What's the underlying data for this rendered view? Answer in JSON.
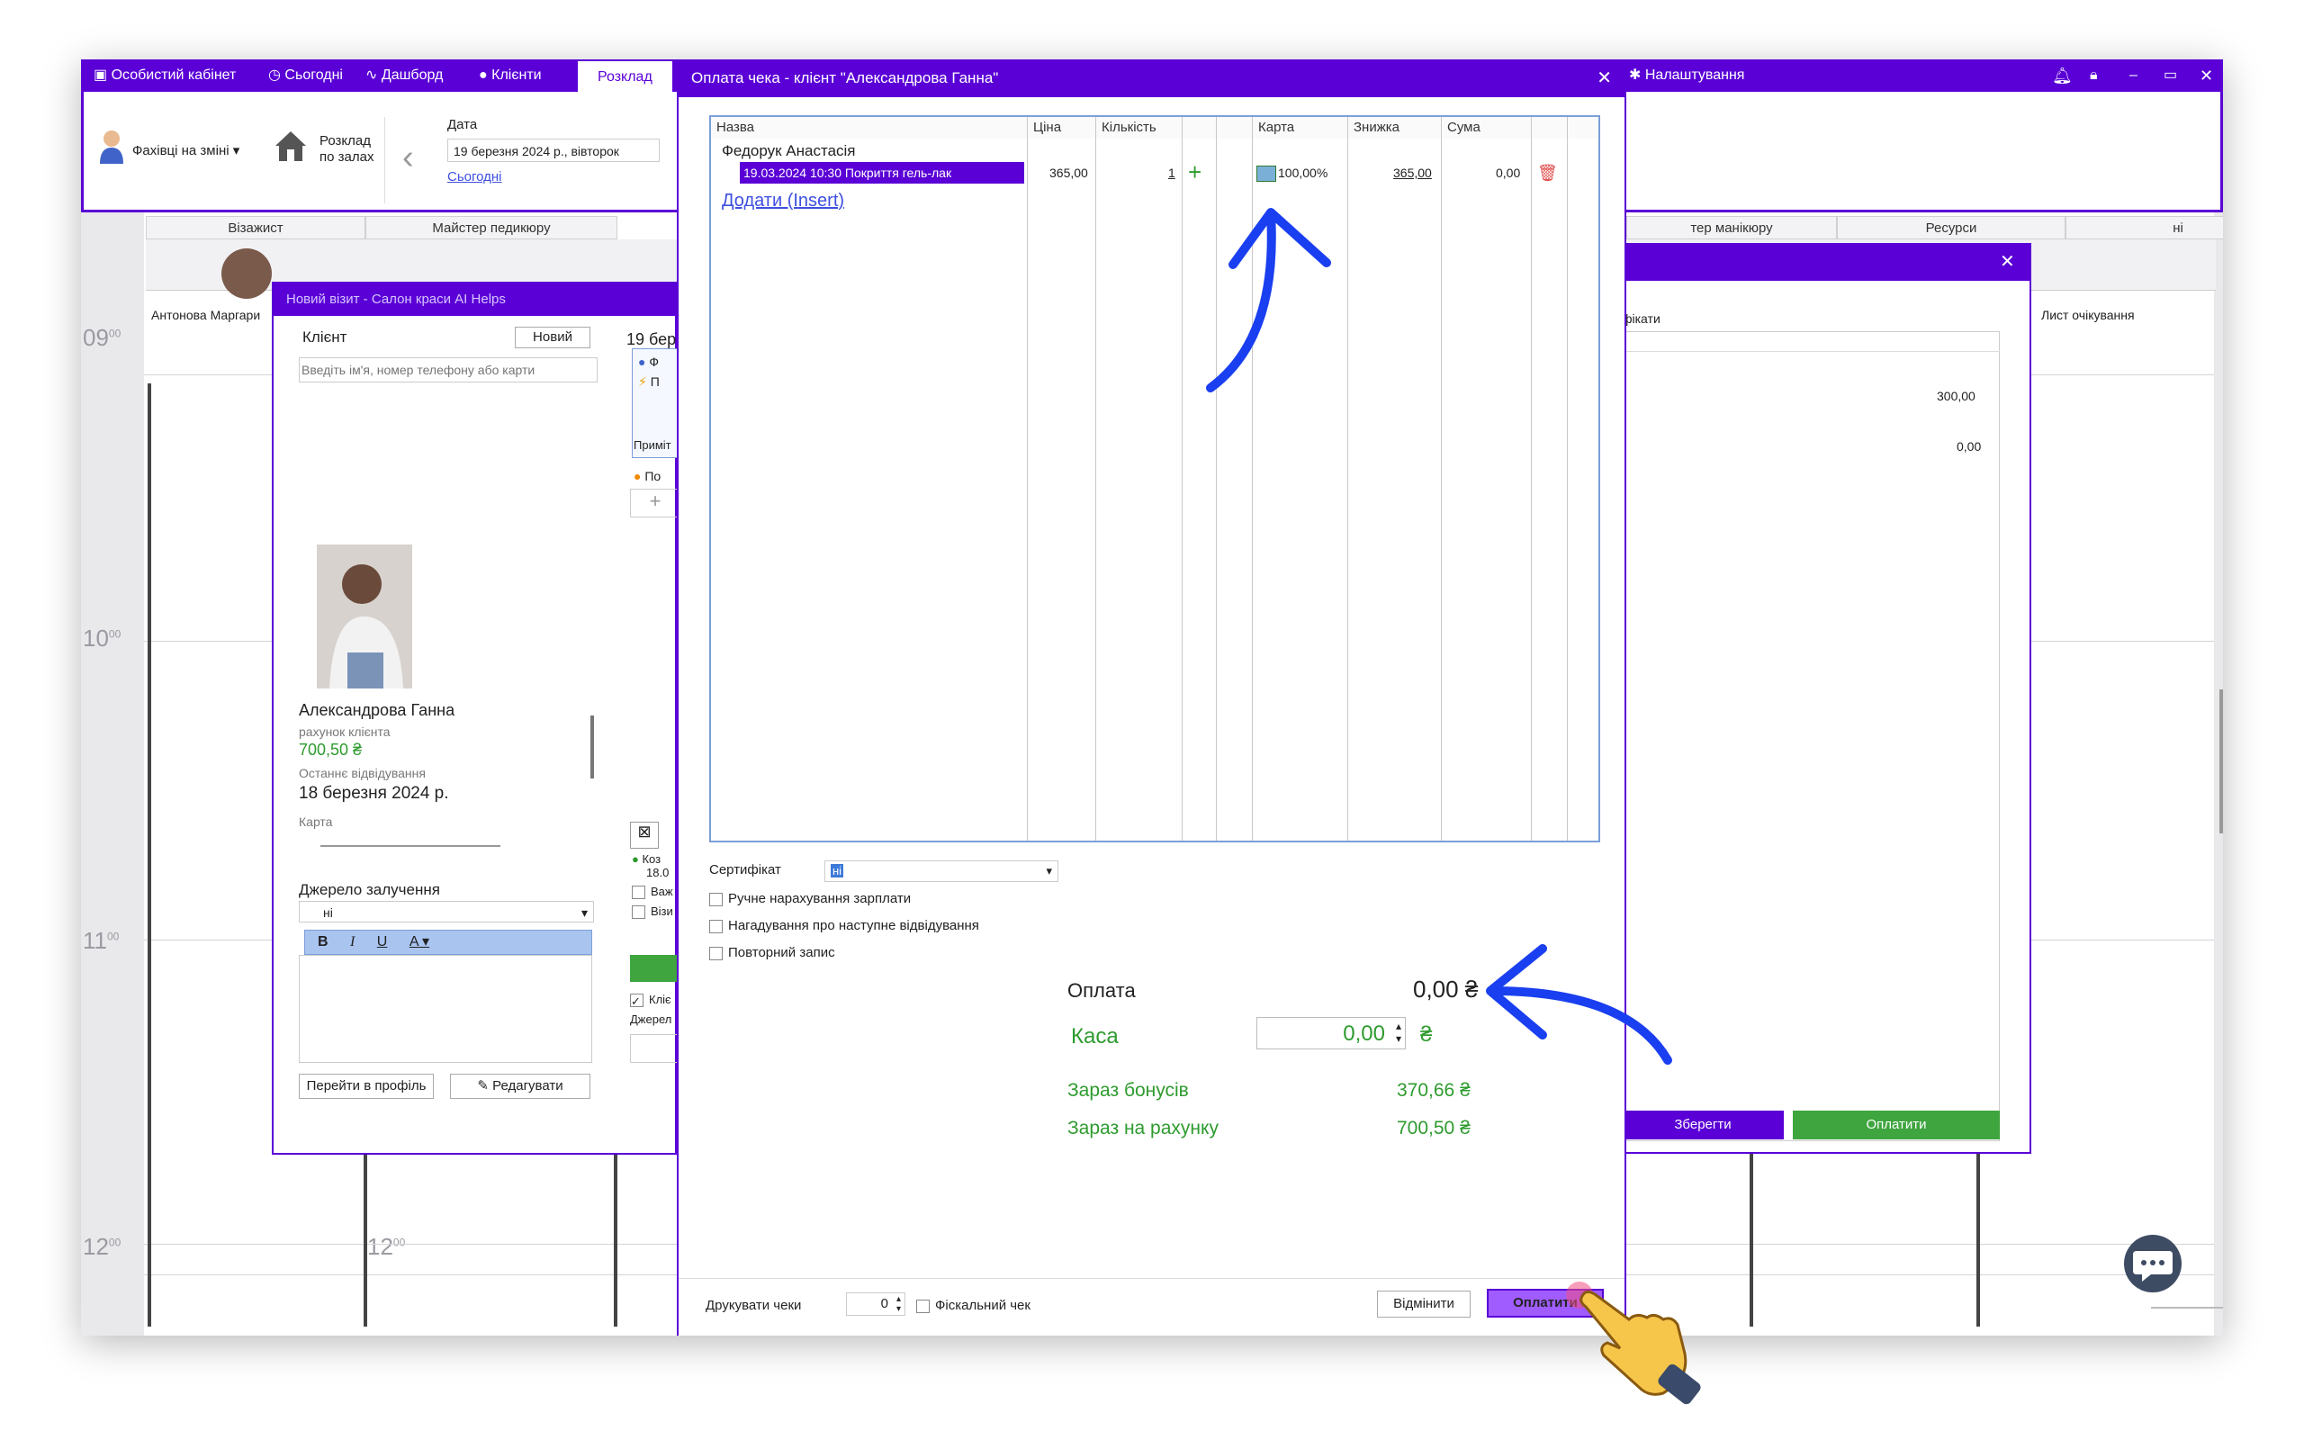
{
  "topbar": {
    "tabs": [
      "Особистий кабінет",
      "Сьогодні",
      "Дашборд",
      "Клієнти",
      "Розклад"
    ],
    "settings": "Налаштування"
  },
  "ribbon": {
    "staff_on_shift": "Фахівці на зміні",
    "schedule_by_halls_line1": "Розклад",
    "schedule_by_halls_line2": "по залах",
    "date_label": "Дата",
    "date_value": "19 березня 2024 р., вівторок",
    "today_link": "Сьогодні"
  },
  "schedule": {
    "columns": [
      "Візажист",
      "Майстер педикюру",
      "тер манікюру",
      "Ресурси",
      "ні"
    ],
    "staff_name": "Антонова Маргари",
    "waiting_list": "Лист очікування",
    "times": [
      "09",
      "10",
      "11",
      "12"
    ],
    "minutes": "00"
  },
  "visit_dialog": {
    "title": "Новий візит - Салон краси AI Helps",
    "client_label": "Клієнт",
    "new_button": "Новий",
    "search_placeholder": "Введіть ім'я, номер телефону або карти",
    "date_partial": "19 бере",
    "client_name": "Александрова Ганна",
    "account_label": "рахунок клієнта",
    "account_value": "700,50 ₴",
    "last_visit_label": "Останнє відвідування",
    "last_visit_value": "18 березня 2024 р.",
    "card_label": "Карта",
    "source_label": "Джерело залучення",
    "source_value": "ні",
    "profile_button": "Перейти в профіль",
    "edit_button": "Редагувати",
    "note_partial": "Приміт",
    "row_a": "Ф",
    "row_b": "П",
    "row_c": "По",
    "col2_items": [
      "Коз",
      "18.0",
      "Важ",
      "Візи",
      "Кліє",
      "Джерел"
    ]
  },
  "right_dialog": {
    "certificates_partial": "фікати",
    "amount1": "300,00",
    "amount2": "0,00",
    "save_button": "Зберегти",
    "pay_button": "Оплатити"
  },
  "payment_dialog": {
    "title": "Оплата чека - клієнт \"Александрова Ганна\"",
    "columns": [
      "Назва",
      "Ціна",
      "Кількість",
      "Карта",
      "Знижка",
      "Сума"
    ],
    "master": "Федорук Анастасія",
    "item": {
      "name": "19.03.2024 10:30 Покриття гель-лак",
      "price": "365,00",
      "qty": "1",
      "card": "100,00%",
      "discount": "365,00",
      "sum": "0,00"
    },
    "add_link": "Додати (Insert)",
    "certificate_label": "Сертифікат",
    "certificate_value": "ні",
    "manual_salary": "Ручне нарахування зарплати",
    "remind_next": "Нагадування про наступне відвідування",
    "repeat_record": "Повторний запис",
    "payment_label": "Оплата",
    "payment_value": "0,00 ₴",
    "cash_label": "Каса",
    "cash_value": "0,00",
    "currency": "₴",
    "bonuses_label": "Зараз бонусів",
    "bonuses_value": "370,66 ₴",
    "account_label": "Зараз на рахунку",
    "account_value": "700,50 ₴",
    "print_checks_label": "Друкувати чеки",
    "print_checks_value": "0",
    "fiscal_check": "Фіскальний чек",
    "cancel_button": "Відмінити",
    "pay_button": "Оплатити"
  },
  "colors": {
    "accent": "#5a00d6",
    "green": "#2e9b2e",
    "arrow": "#1a3ff0"
  }
}
